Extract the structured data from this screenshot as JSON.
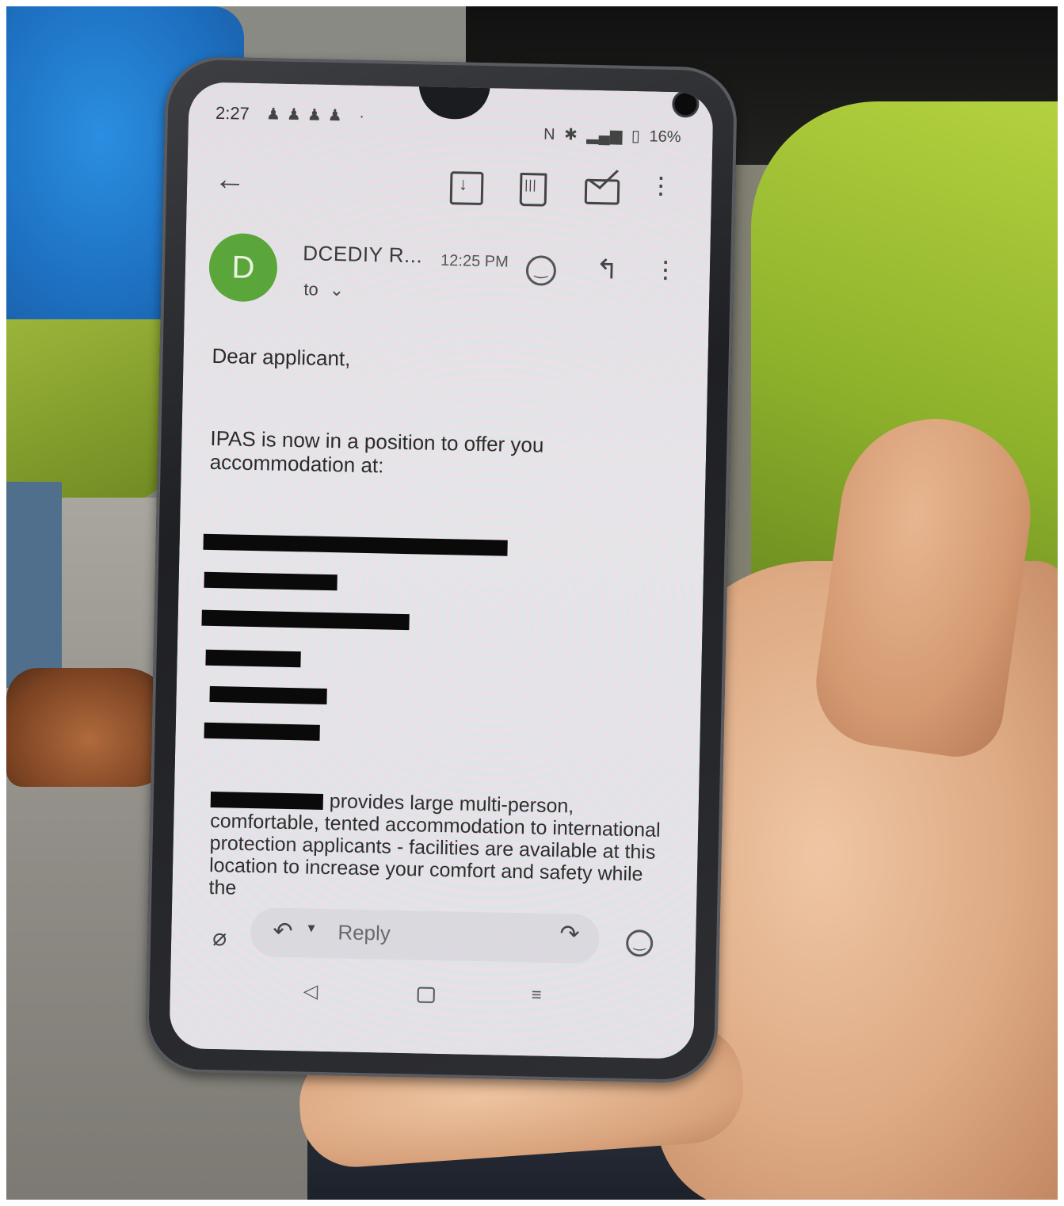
{
  "status_bar": {
    "time": "2:27",
    "notification_icons": [
      "snapchat-icon",
      "snapchat-icon",
      "snapchat-icon",
      "snapchat-icon"
    ],
    "battery": "16%"
  },
  "email": {
    "avatar_letter": "D",
    "sender": "DCEDIY R...",
    "time": "12:25 PM",
    "to_label": "to",
    "greeting": "Dear applicant,",
    "offer_line": "IPAS is now in a position to offer you accommodation at:",
    "paragraph": "provides large multi-person, comfortable, tented accommodation to international protection applicants - facilities are available at this location to increase your comfort and safety while the"
  },
  "compose": {
    "reply_label": "Reply"
  },
  "colors": {
    "avatar": "#5aa63a",
    "redaction": "#0a0a0a"
  }
}
